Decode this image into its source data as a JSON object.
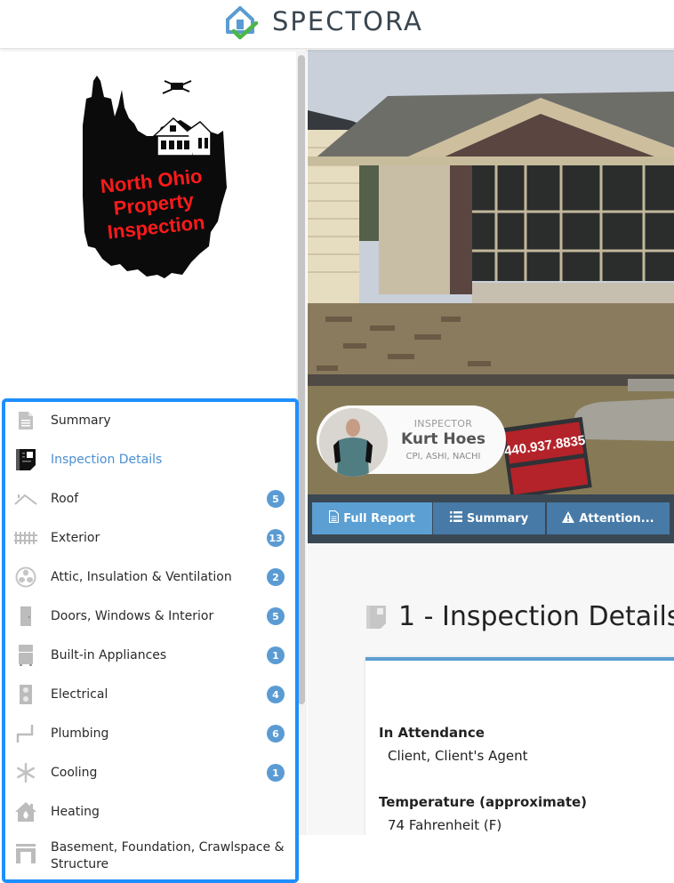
{
  "header": {
    "brand": "SPECTORA",
    "brand_colors": {
      "house": "#5b9bd3",
      "check": "#4cb648",
      "text": "#3a4650"
    }
  },
  "sidebar": {
    "logo": {
      "lines": [
        "North Ohio",
        "Property",
        "Inspection"
      ],
      "text_color": "#ff0000"
    },
    "items": [
      {
        "label": "Summary",
        "icon": "document-icon",
        "badge": null,
        "active": false
      },
      {
        "label": "Inspection Details",
        "icon": "inspection-details-icon",
        "badge": null,
        "active": true
      },
      {
        "label": "Roof",
        "icon": "roof-icon",
        "badge": "5",
        "active": false
      },
      {
        "label": "Exterior",
        "icon": "fence-icon",
        "badge": "13",
        "active": false
      },
      {
        "label": "Attic, Insulation & Ventilation",
        "icon": "fan-icon",
        "badge": "2",
        "active": false
      },
      {
        "label": "Doors, Windows & Interior",
        "icon": "door-icon",
        "badge": "5",
        "active": false
      },
      {
        "label": "Built-in Appliances",
        "icon": "fridge-icon",
        "badge": "1",
        "active": false
      },
      {
        "label": "Electrical",
        "icon": "outlet-icon",
        "badge": "4",
        "active": false
      },
      {
        "label": "Plumbing",
        "icon": "pipe-icon",
        "badge": "6",
        "active": false
      },
      {
        "label": "Cooling",
        "icon": "snowflake-icon",
        "badge": "1",
        "active": false
      },
      {
        "label": "Heating",
        "icon": "house-fire-icon",
        "badge": null,
        "active": false
      },
      {
        "label": "Basement, Foundation, Crawlspace & Structure",
        "icon": "foundation-icon",
        "badge": null,
        "active": false
      }
    ],
    "highlight_color": "#1e8fff",
    "badge_color": "#5b9bd3",
    "active_color": "#4a8fd0"
  },
  "inspector": {
    "role": "INSPECTOR",
    "name": "Kurt Hoes",
    "certifications": "CPI, ASHI, NACHI"
  },
  "hero": {
    "sign_phone": "440.937.8835"
  },
  "tabs": [
    {
      "label": "Full Report",
      "icon": "document-icon",
      "active": true
    },
    {
      "label": "Summary",
      "icon": "list-icon",
      "active": false
    },
    {
      "label": "Attention...",
      "icon": "warning-icon",
      "active": false
    }
  ],
  "section": {
    "title": "1 - Inspection Details",
    "fields": [
      {
        "label": "In Attendance",
        "value": "Client, Client's Agent"
      },
      {
        "label": "Temperature (approximate)",
        "value": "74 Fahrenheit (F)"
      }
    ]
  }
}
